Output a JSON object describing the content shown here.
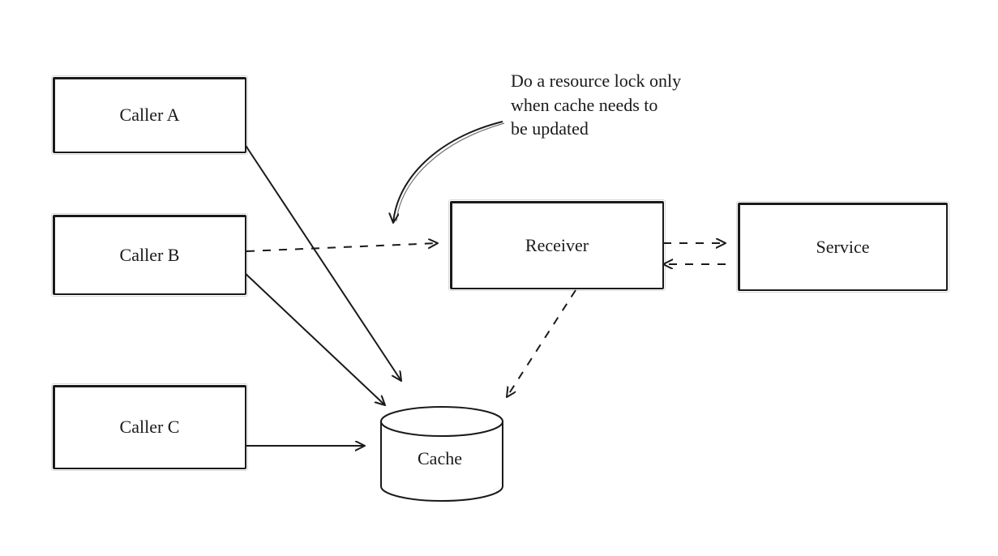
{
  "nodes": {
    "caller_a": "Caller A",
    "caller_b": "Caller B",
    "caller_c": "Caller C",
    "receiver": "Receiver",
    "service": "Service",
    "cache": "Cache"
  },
  "annotation": {
    "text": "Do a resource lock only\nwhen cache needs to\nbe updated"
  },
  "edges": [
    {
      "name": "caller-a-to-cache",
      "style": "solid",
      "kind": "single"
    },
    {
      "name": "caller-b-to-cache",
      "style": "solid",
      "kind": "single"
    },
    {
      "name": "caller-c-to-cache",
      "style": "solid",
      "kind": "single"
    },
    {
      "name": "caller-b-to-receiver",
      "style": "dashed",
      "kind": "single"
    },
    {
      "name": "receiver-to-cache",
      "style": "dashed",
      "kind": "single"
    },
    {
      "name": "receiver-service",
      "style": "dashed",
      "kind": "bidir"
    },
    {
      "name": "annotation-pointer",
      "style": "solid",
      "kind": "curved"
    }
  ],
  "colors": {
    "stroke": "#1a1a1a",
    "bg": "#ffffff"
  }
}
